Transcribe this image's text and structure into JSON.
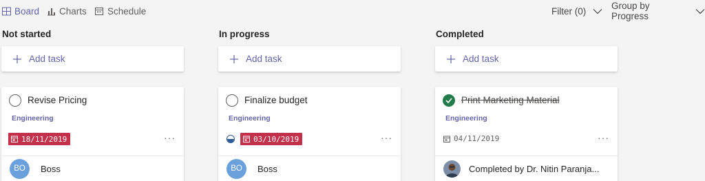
{
  "toolbar": {
    "tabs": [
      {
        "label": "Board",
        "icon": "board-icon",
        "active": true
      },
      {
        "label": "Charts",
        "icon": "charts-icon",
        "active": false
      },
      {
        "label": "Schedule",
        "icon": "schedule-icon",
        "active": false
      }
    ],
    "filter_label": "Filter (0)",
    "group_label": "Group by Progress"
  },
  "colors": {
    "accent": "#6264a7",
    "overdue": "#c4314b",
    "done": "#237b4b",
    "avatar": "#6aa0dc"
  },
  "columns": [
    {
      "title": "Not started",
      "add_label": "Add task",
      "task": {
        "title": "Revise Pricing",
        "label": "Engineering",
        "date": "18/11/2019",
        "date_state": "overdue",
        "assignee_initials": "BO",
        "assignee": "Boss"
      }
    },
    {
      "title": "In progress",
      "add_label": "Add task",
      "task": {
        "title": "Finalize budget",
        "label": "Engineering",
        "date": "03/10/2019",
        "date_state": "overdue",
        "progress": 0.5,
        "assignee_initials": "BO",
        "assignee": "Boss"
      }
    },
    {
      "title": "Completed",
      "add_label": "Add task",
      "task": {
        "title": "Print Marketing Material",
        "label": "Engineering",
        "date": "04/11/2019",
        "date_state": "normal",
        "completed": true,
        "assignee": "Completed by Dr. Nitin Paranja..."
      }
    }
  ]
}
